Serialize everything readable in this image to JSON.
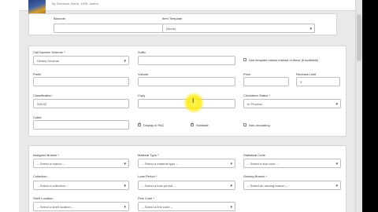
{
  "header": {
    "byline": "By Ziomecki, Mario, 1905- author"
  },
  "item_top": {
    "barcode_label": "Barcode",
    "barcode_value": "",
    "item_template_label": "Item Template",
    "item_template_value": "(None)"
  },
  "call_number": {
    "scheme_label": "Call Number Scheme *",
    "scheme_value": "Dewey Decimal",
    "suffix_label": "Suffix",
    "suffix_value": "",
    "use_template_label": "Use template values instead of these (if available)",
    "prefix_label": "Prefix",
    "prefix_value": "",
    "volume_label": "Volume",
    "volume_value": "",
    "price_label": "Price",
    "price_value": "",
    "renewal_limit_label": "Renewal Limit",
    "renewal_limit_value": "3",
    "classification_label": "Classification",
    "classification_value": "938.92",
    "copy_label": "Copy",
    "copy_value": "",
    "circ_status_label": "Circulation Status *",
    "circ_status_value": "In Process",
    "cutter_label": "Cutter",
    "cutter_value": "",
    "display_opac_label": "Display in PAC",
    "holdable_label": "Holdable",
    "non_circulating_label": "Non-circulating"
  },
  "branch_section": {
    "assigned_branch_label": "Assigned Branch *",
    "assigned_branch_value": "-- Select a branch --",
    "material_type_label": "Material Type *",
    "material_type_value": "-- Select a material type --",
    "statistical_code_label": "Statistical Code",
    "statistical_code_value": "-- Select a stat code --",
    "collection_label": "Collection",
    "collection_value": "-- Select a collection --",
    "loan_period_label": "Loan Period *",
    "loan_period_value": "-- Select a loan period --",
    "owning_branch_label": "Owning Branch *",
    "owning_branch_value": "-- Select an owning branch --",
    "shelf_location_label": "Shelf Location",
    "shelf_location_value": "-- Select a shelf location --",
    "fine_code_label": "Fine Code *",
    "fine_code_value": "-- Select a fine code --"
  },
  "icons": {
    "caret": "▾",
    "cursor": "I"
  },
  "colors": {
    "page_bg": "#e9e9e9",
    "highlight": "#ffeb00"
  }
}
